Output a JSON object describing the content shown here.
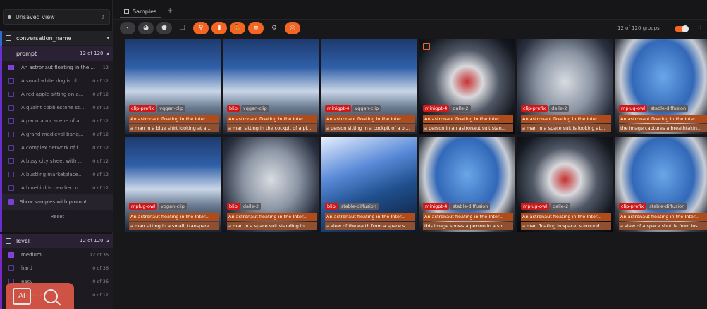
{
  "sidebar": {
    "view_label": "Unsaved view",
    "groups": {
      "conversation": {
        "name": "conversation_name"
      },
      "prompt": {
        "name": "prompt",
        "count": "12 of 120",
        "items": [
          {
            "text": "An astronaut floating in the ...",
            "count": "12",
            "checked": true
          },
          {
            "text": "A small white dog is pl...",
            "count": "0 of 12",
            "checked": false
          },
          {
            "text": "A red apple sitting on a...",
            "count": "0 of 12",
            "checked": false
          },
          {
            "text": "A quaint cobblestone st...",
            "count": "0 of 12",
            "checked": false
          },
          {
            "text": "A panoramic scene of a...",
            "count": "0 of 12",
            "checked": false
          },
          {
            "text": "A grand medieval banq...",
            "count": "0 of 12",
            "checked": false
          },
          {
            "text": "A complex network of f...",
            "count": "0 of 12",
            "checked": false
          },
          {
            "text": "A busy city street with ...",
            "count": "0 of 12",
            "checked": false
          },
          {
            "text": "A bustling marketplace...",
            "count": "0 of 12",
            "checked": false
          },
          {
            "text": "A bluebird is perched o...",
            "count": "0 of 12",
            "checked": false
          }
        ],
        "show_samples": "Show samples with prompt",
        "reset": "Reset"
      },
      "level": {
        "name": "level",
        "count": "12 of 120",
        "items": [
          {
            "text": "medium",
            "count": "12 of 36",
            "checked": true
          },
          {
            "text": "hard",
            "count": "0 of 36",
            "checked": false
          },
          {
            "text": "easy",
            "count": "0 of 36",
            "checked": false
          },
          {
            "text": "impossible",
            "count": "0 of 12",
            "checked": false
          }
        ]
      }
    },
    "badge_text": "AI"
  },
  "topbar": {
    "tab_label": "Samples",
    "plus": "+"
  },
  "toolbar": {
    "groups_label": "12 of 120 groups"
  },
  "colors": {
    "accent": "#f26522",
    "prompt_border": "#6a2fd0",
    "tag_red": "#d01818"
  },
  "samples": [
    {
      "model": "clip-prefix",
      "gen": "vqgan-clip",
      "prompt": "An astronaut floating in the Inter...",
      "caption": "a man in a blue shirt looking at a...",
      "bg": "bg-cockpit"
    },
    {
      "model": "blip",
      "gen": "vqgan-clip",
      "prompt": "An astronaut floating in the Inter...",
      "caption": "a man sitting in the cockpit of a pl...",
      "bg": "bg-cockpit"
    },
    {
      "model": "minigpt-4",
      "gen": "vqgan-clip",
      "prompt": "An astronaut floating in the Inter...",
      "caption": "a person sitting in a cockpit of a pl...",
      "bg": "bg-cockpit"
    },
    {
      "model": "minigpt-4",
      "gen": "dalle-2",
      "prompt": "An astronaut floating in the Inter...",
      "caption": "a person in an astronaut suit stan...",
      "bg": "bg-dark"
    },
    {
      "model": "clip-prefix",
      "gen": "dalle-2",
      "prompt": "An astronaut floating in the Inter...",
      "caption": "a man in a space suit is looking at...",
      "bg": "bg-suit"
    },
    {
      "model": "mplug-owl",
      "gen": "stable-diffusion",
      "prompt": "An astronaut floating in the Inter...",
      "caption": "the image captures a breathtakin...",
      "bg": "bg-window"
    },
    {
      "model": "mplug-owl",
      "gen": "vqgan-clip",
      "prompt": "An astronaut floating in the Inter...",
      "caption": "a man sitting in a small, transpare...",
      "bg": "bg-cockpit"
    },
    {
      "model": "blip",
      "gen": "dalle-2",
      "prompt": "An astronaut floating in the Inter...",
      "caption": "a man in a space suit standing in ...",
      "bg": "bg-suit"
    },
    {
      "model": "blip",
      "gen": "stable-diffusion",
      "prompt": "An astronaut floating in the Inter...",
      "caption": "a view of the earth from a space s...",
      "bg": "bg-earth"
    },
    {
      "model": "minigpt-4",
      "gen": "stable-diffusion",
      "prompt": "An astronaut floating in the Inter...",
      "caption": "this image shows a person in a sp...",
      "bg": "bg-window"
    },
    {
      "model": "mplug-owl",
      "gen": "dalle-2",
      "prompt": "An astronaut floating in the Inter...",
      "caption": "a man floating in space, surround...",
      "bg": "bg-dark"
    },
    {
      "model": "clip-prefix",
      "gen": "stable-diffusion",
      "prompt": "An astronaut floating in the Inter...",
      "caption": "a view of a space shuttle from ins...",
      "bg": "bg-window"
    }
  ]
}
